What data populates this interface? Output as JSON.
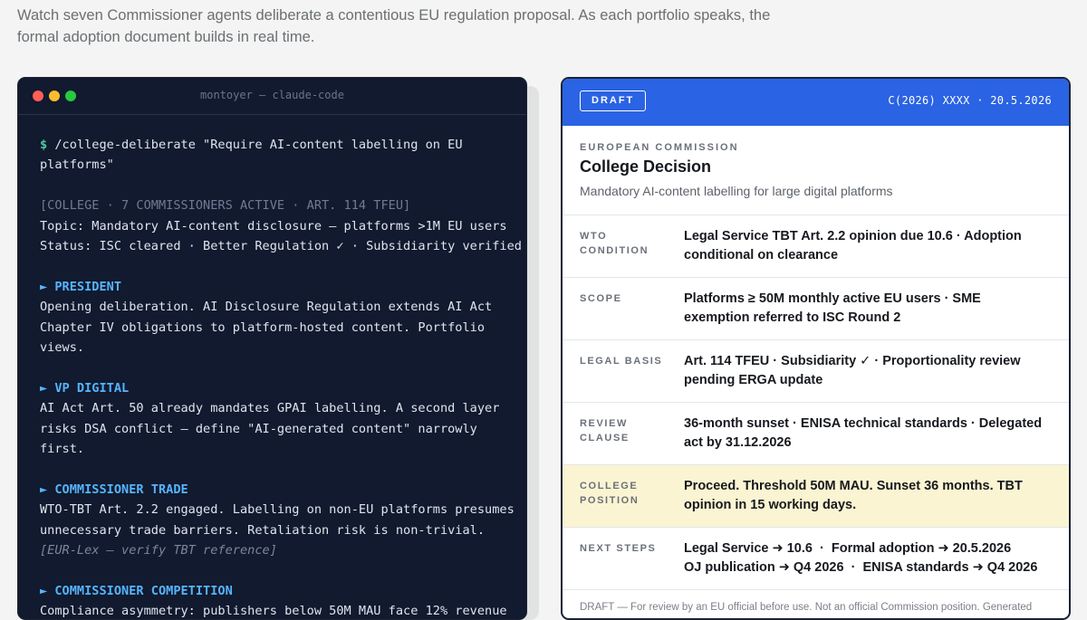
{
  "intro": {
    "line1": "Watch seven Commissioner agents deliberate a contentious EU regulation proposal. As each portfolio speaks, the",
    "line2": "formal adoption document builds in real time."
  },
  "terminal": {
    "title": "montoyer — claude-code",
    "prompt_symbol": "$",
    "command_l1": "/college-deliberate \"Require AI-content labelling on EU",
    "command_l2": "platforms\"",
    "header_l1": "[COLLEGE · 7 COMMISSIONERS ACTIVE · ART. 114 TFEU]",
    "header_l2": "Topic: Mandatory AI-content disclosure — platforms >1M EU users",
    "header_l3": "Status: ISC cleared · Better Regulation ✓ · Subsidiarity verified",
    "sections": [
      {
        "role": "► PRESIDENT",
        "lines": [
          "Opening deliberation. AI Disclosure Regulation extends AI Act",
          "Chapter IV obligations to platform-hosted content. Portfolio",
          "views."
        ]
      },
      {
        "role": "► VP DIGITAL",
        "lines": [
          "AI Act Art. 50 already mandates GPAI labelling. A second layer",
          "risks DSA conflict — define \"AI-generated content\" narrowly",
          "first."
        ]
      },
      {
        "role": "► COMMISSIONER TRADE",
        "lines": [
          "WTO-TBT Art. 2.2 engaged. Labelling on non-EU platforms presumes",
          "unnecessary trade barriers. Retaliation risk is non-trivial."
        ],
        "note": "[EUR-Lex — verify TBT reference]"
      },
      {
        "role": "► COMMISSIONER COMPETITION",
        "lines": [
          "Compliance asymmetry: publishers below 50M MAU face 12% revenue"
        ]
      }
    ]
  },
  "doc": {
    "badge": "DRAFT",
    "ref": "C(2026) XXXX · 20.5.2026",
    "org": "EUROPEAN COMMISSION",
    "title": "College Decision",
    "subtitle": "Mandatory AI-content labelling for large digital platforms",
    "rows": [
      {
        "label_l1": "WTO",
        "label_l2": "CONDITION",
        "value_l1": "Legal Service TBT Art. 2.2 opinion due 10.6 · Adoption",
        "value_l2": "conditional on clearance"
      },
      {
        "label_l1": "SCOPE",
        "label_l2": "",
        "value_l1": "Platforms ≥ 50M monthly active EU users · SME",
        "value_l2": "exemption referred to ISC Round 2"
      },
      {
        "label_l1": "LEGAL BASIS",
        "label_l2": "",
        "value_l1": "Art. 114 TFEU · Subsidiarity ✓ · Proportionality review",
        "value_l2": "pending ERGA update"
      },
      {
        "label_l1": "REVIEW",
        "label_l2": "CLAUSE",
        "value_l1": "36-month sunset · ENISA technical standards · Delegated",
        "value_l2": "act by 31.12.2026"
      },
      {
        "label_l1": "COLLEGE",
        "label_l2": "POSITION",
        "value_l1": "Proceed. Threshold 50M MAU. Sunset 36 months. TBT",
        "value_l2": "opinion in 15 working days."
      },
      {
        "label_l1": "NEXT STEPS",
        "label_l2": "",
        "value_l1": "Legal Service ➜ 10.6  ·  Formal adoption ➜ 20.5.2026",
        "value_l2": "OJ publication ➜ Q4 2026  ·  ENISA standards ➜ Q4 2026"
      }
    ],
    "footer": "DRAFT — For review by an EU official before use. Not an official Commission position. Generated"
  },
  "colors": {
    "terminal_bg": "#111a2e",
    "doc_header": "#2a63e3",
    "highlight_row": "#fbf4d2",
    "role_accent": "#56b4ff",
    "prompt_accent": "#4ec9a0"
  }
}
